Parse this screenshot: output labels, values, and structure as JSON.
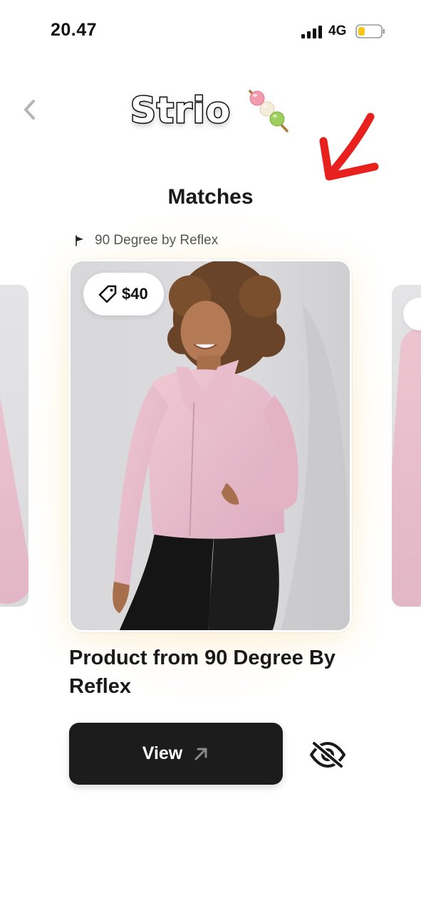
{
  "status_bar": {
    "time": "20.47",
    "network": "4G",
    "signal_icon": "signal-bars-icon",
    "battery_icon": "battery-low-icon",
    "battery_level": 0.25,
    "battery_color": "#F5C518"
  },
  "header": {
    "back_icon": "chevron-left-icon",
    "logo_text": "Strio",
    "logo_emoji_icon": "dango-skewer-icon"
  },
  "annotation": {
    "arrow_icon": "red-arrow-icon",
    "arrow_color": "#E8211F"
  },
  "page": {
    "title": "Matches"
  },
  "brand": {
    "logo_icon": "brand-logo-icon",
    "name": "90 Degree by Reflex"
  },
  "product": {
    "price_icon": "price-tag-icon",
    "price": "$40",
    "title": "Product from 90 Degree By Reflex",
    "image_description_icon": "product-photo-icon"
  },
  "actions": {
    "view_label": "View",
    "view_icon": "arrow-up-right-icon",
    "hide_icon": "eye-slash-icon"
  },
  "colors": {
    "accent_dark": "#1C1C1C",
    "glow": "#FCECC4",
    "jacket_pink": "#E8BFCC"
  }
}
